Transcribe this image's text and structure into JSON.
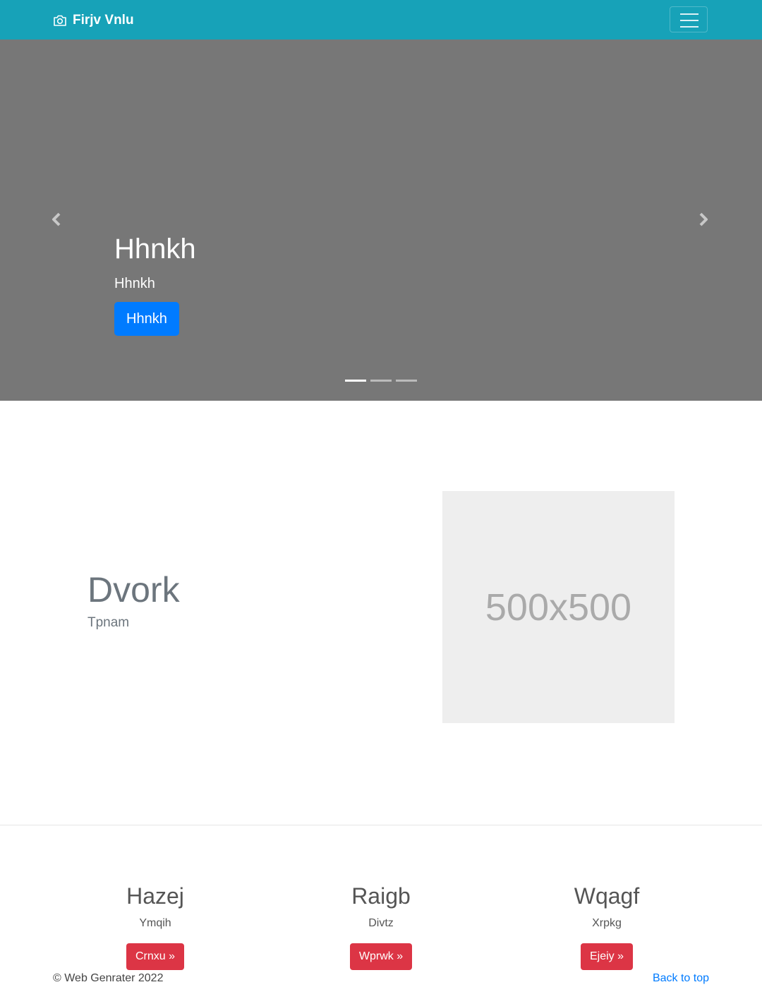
{
  "navbar": {
    "brand": "Firjv Vnlu",
    "brand_icon": "camera-icon",
    "toggler_icon": "hamburger-menu-icon",
    "background": "#17a2b8"
  },
  "carousel": {
    "heading": "Hhnkh",
    "text": "Hhnkh",
    "button_label": "Hhnkh",
    "prev_icon": "chevron-left-icon",
    "next_icon": "chevron-right-icon",
    "slide_count": 3,
    "active_slide": 1,
    "background": "#777777"
  },
  "feature": {
    "heading": "Dvork",
    "lead": "Tpnam",
    "image_placeholder": "500x500"
  },
  "columns": [
    {
      "heading": "Hazej",
      "text": "Ymqih",
      "button_label": "Crnxu »"
    },
    {
      "heading": "Raigb",
      "text": "Divtz",
      "button_label": "Wprwk »"
    },
    {
      "heading": "Wqagf",
      "text": "Xrpkg",
      "button_label": "Ejeiy »"
    }
  ],
  "footer": {
    "copyright": "© Web Genrater 2022",
    "back_to_top": "Back to top"
  },
  "colors": {
    "primary": "#007bff",
    "danger": "#dc3545"
  }
}
